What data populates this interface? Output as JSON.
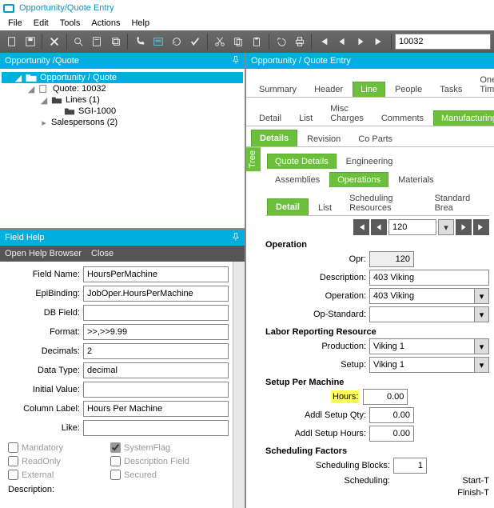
{
  "title": "Opportunity/Quote Entry",
  "menu": {
    "file": "File",
    "edit": "Edit",
    "tools": "Tools",
    "actions": "Actions",
    "help": "Help"
  },
  "toolbar": {
    "search_value": "10032"
  },
  "left_panel": {
    "title": "Opportunity /Quote"
  },
  "tree": {
    "root": "Opportunity / Quote",
    "quote": "Quote: 10032",
    "lines": "Lines (1)",
    "item": "SGI-1000",
    "salespersons": "Salespersons (2)"
  },
  "field_help": {
    "title": "Field Help",
    "open": "Open Help Browser",
    "close": "Close",
    "labels": {
      "field_name": "Field Name:",
      "epi_binding": "EpiBinding:",
      "db_field": "DB Field:",
      "format": "Format:",
      "decimals": "Decimals:",
      "data_type": "Data Type:",
      "initial_value": "Initial Value:",
      "column_label": "Column Label:",
      "like": "Like:"
    },
    "values": {
      "field_name": "HoursPerMachine",
      "epi_binding": "JobOper.HoursPerMachine",
      "db_field": "",
      "format": ">>,>>9.99",
      "decimals": "2",
      "data_type": "decimal",
      "initial_value": "",
      "column_label": "Hours Per Machine",
      "like": ""
    },
    "checks": {
      "mandatory": "Mandatory",
      "systemflag": "SystemFlag",
      "readonly": "ReadOnly",
      "descfield": "Description Field",
      "external": "External",
      "secured": "Secured"
    },
    "description": "Description:"
  },
  "right_panel": {
    "title": "Opportunity / Quote Entry"
  },
  "tabs1": {
    "summary": "Summary",
    "header": "Header",
    "line": "Line",
    "people": "People",
    "tasks": "Tasks",
    "onetime": "One Time"
  },
  "tabs2": {
    "detail": "Detail",
    "list": "List",
    "misc": "Misc Charges",
    "comments": "Comments",
    "manufacturing": "Manufacturing"
  },
  "tabs3": {
    "details": "Details",
    "revision": "Revision",
    "coparts": "Co Parts"
  },
  "vtab": "Tree",
  "tabs4": {
    "quotedetails": "Quote Details",
    "engineering": "Engineering"
  },
  "tabs5": {
    "assemblies": "Assemblies",
    "operations": "Operations",
    "materials": "Materials"
  },
  "tabs6": {
    "detail": "Detail",
    "list": "List",
    "sched": "Scheduling Resources",
    "std": "Standard Brea"
  },
  "nav": {
    "value": "120"
  },
  "operation": {
    "title": "Operation",
    "opr_label": "Opr:",
    "opr": "120",
    "desc_label": "Description:",
    "desc": "403 Viking",
    "op_label": "Operation:",
    "op": "403 Viking",
    "opstd_label": "Op-Standard:",
    "opstd": ""
  },
  "labor": {
    "title": "Labor Reporting Resource",
    "prod_label": "Production:",
    "prod": "Viking 1",
    "setup_label": "Setup:",
    "setup": "Viking 1"
  },
  "spm": {
    "title": "Setup Per Machine",
    "hours_label": "Hours:",
    "hours": "0.00",
    "addlqty_label": "Addl Setup Qty:",
    "addlqty": "0.00",
    "addlhrs_label": "Addl Setup Hours:",
    "addlhrs": "0.00"
  },
  "sched": {
    "title": "Scheduling Factors",
    "blocks_label": "Scheduling Blocks:",
    "blocks": "1",
    "sched_label": "Scheduling:",
    "start": "Start-T",
    "finish": "Finish-T"
  }
}
